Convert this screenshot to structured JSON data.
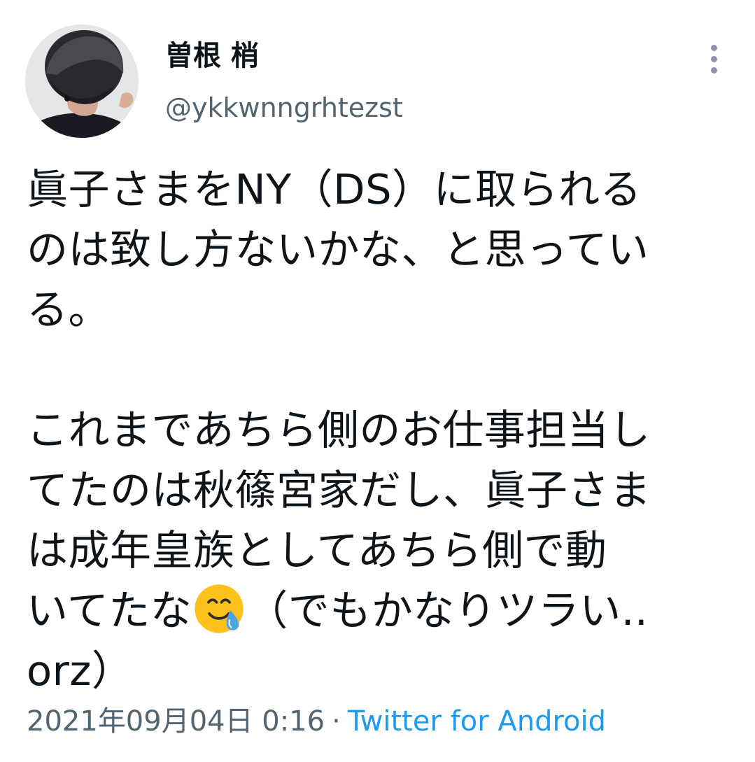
{
  "author": {
    "name": "曽根 梢",
    "handle": "@ykkwnngrhtezst",
    "avatar_icon": "avatar-photo"
  },
  "more_icon": "more-vertical-icon",
  "tweet": {
    "lines": [
      "眞子さまをNY（DS）に取られる",
      "のは致し方ないかな、と思ってい",
      "る。",
      "",
      "これまであちら側のお仕事担当し",
      "てたのは秋篠宮家だし、眞子さま",
      "は成年皇族としてあちら側で動"
    ],
    "line_emoji_before": "いてたな",
    "emoji_name": "smiling-face-with-tear-emoji",
    "line_emoji_after": "（でもかなりツラい..",
    "last_line": "orz）"
  },
  "meta": {
    "timestamp": "2021年09月04日 0:16",
    "separator": "·",
    "source": "Twitter for Android"
  },
  "colors": {
    "text": "#0f1419",
    "secondary": "#536471",
    "link": "#1d9bf0"
  }
}
